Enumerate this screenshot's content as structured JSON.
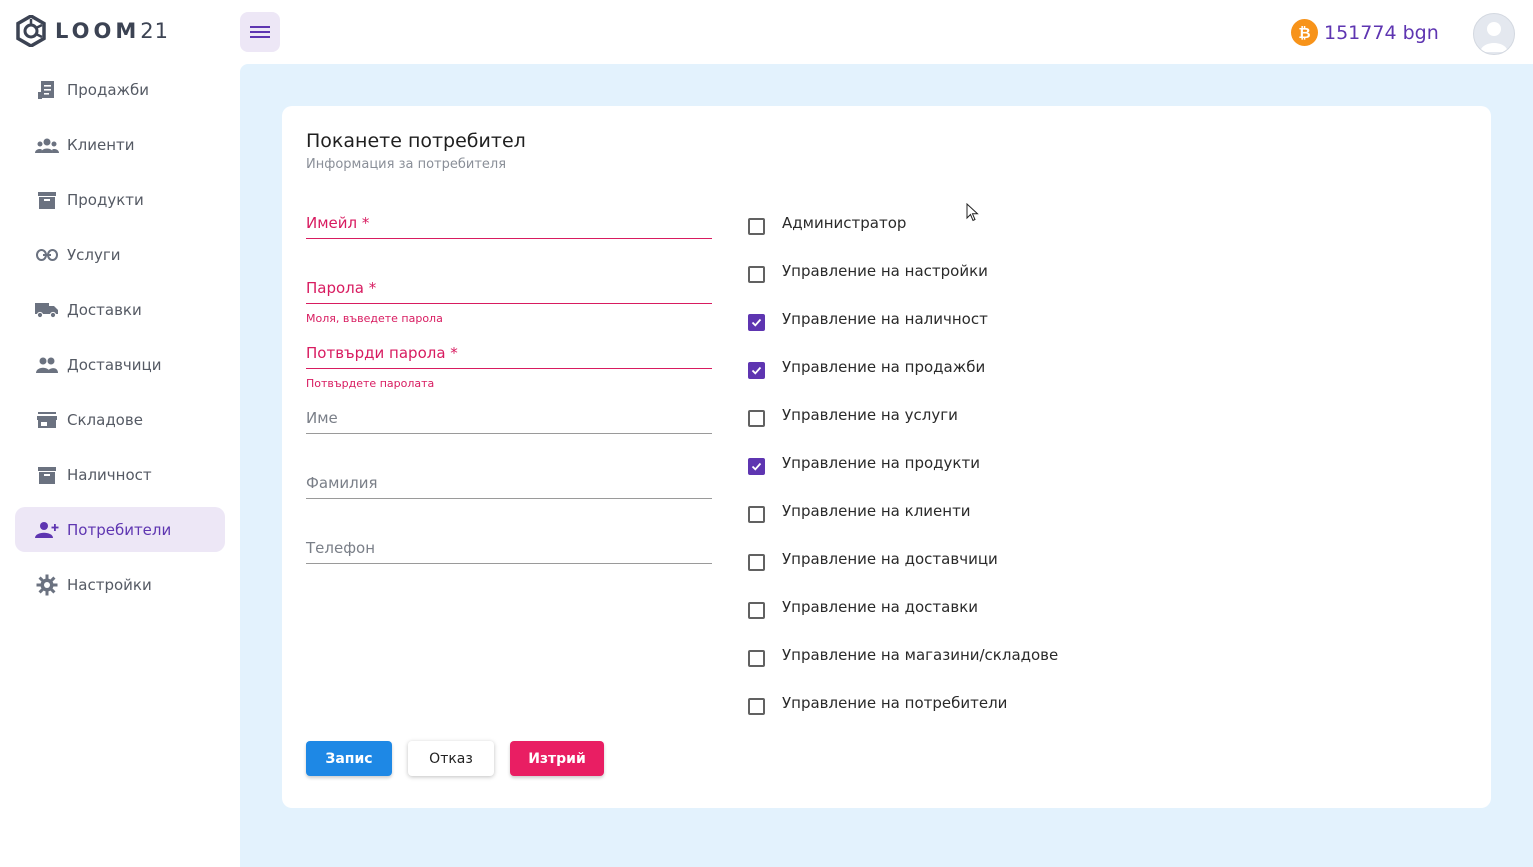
{
  "header": {
    "logo_text": "LOOM",
    "logo_num": "21",
    "balance": "151774 bgn",
    "coin_symbol": "₿"
  },
  "sidebar": {
    "items": [
      {
        "label": "Продажби",
        "icon": "receipt-icon"
      },
      {
        "label": "Клиенти",
        "icon": "people-icon"
      },
      {
        "label": "Продукти",
        "icon": "archive-box-icon"
      },
      {
        "label": "Услуги",
        "icon": "link-icon"
      },
      {
        "label": "Доставки",
        "icon": "truck-icon"
      },
      {
        "label": "Доставчици",
        "icon": "group-icon"
      },
      {
        "label": "Складове",
        "icon": "store-icon"
      },
      {
        "label": "Наличност",
        "icon": "inventory-box-icon"
      },
      {
        "label": "Потребители",
        "icon": "person-add-icon",
        "active": true
      },
      {
        "label": "Настройки",
        "icon": "gear-icon"
      }
    ]
  },
  "form": {
    "title": "Поканете потребител",
    "subtitle": "Информация за потребителя",
    "fields": {
      "email": {
        "label": "Имейл *"
      },
      "password": {
        "label": "Парола *",
        "helper": "Моля, въведете парола"
      },
      "confirm": {
        "label": "Потвърди парола *",
        "helper": "Потвърдете паролата"
      },
      "first_name": {
        "label": "Име"
      },
      "last_name": {
        "label": "Фамилия"
      },
      "phone": {
        "label": "Телефон"
      }
    },
    "permissions": [
      {
        "label": "Администратор",
        "checked": false
      },
      {
        "label": "Управление на настройки",
        "checked": false
      },
      {
        "label": "Управление на наличност",
        "checked": true
      },
      {
        "label": "Управление на продажби",
        "checked": true
      },
      {
        "label": "Управление на услуги",
        "checked": false
      },
      {
        "label": "Управление на продукти",
        "checked": true
      },
      {
        "label": "Управление на клиенти",
        "checked": false
      },
      {
        "label": "Управление на доставчици",
        "checked": false
      },
      {
        "label": "Управление на доставки",
        "checked": false
      },
      {
        "label": "Управление на магазини/складове",
        "checked": false
      },
      {
        "label": "Управление на потребители",
        "checked": false
      }
    ],
    "buttons": {
      "save": "Запис",
      "cancel": "Отказ",
      "delete": "Изтрий"
    }
  },
  "colors": {
    "accent": "#5e35b1",
    "primary": "#1e88e5",
    "danger": "#e91e63",
    "error": "#d81b60",
    "main_bg": "#e3f2fd"
  }
}
